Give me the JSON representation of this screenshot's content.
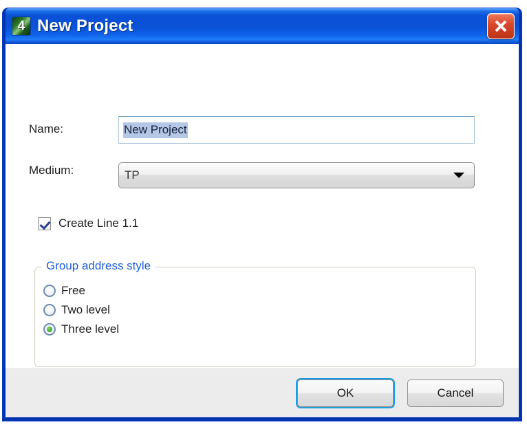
{
  "window": {
    "title": "New Project",
    "app_icon": "app-logo-icon",
    "app_icon_glyph": "4",
    "close_label": "close-icon",
    "accent_titlebar": "#0a51d8",
    "close_button_color": "#d9472a"
  },
  "form": {
    "name": {
      "label": "Name:",
      "value": "New Project",
      "selected": true,
      "selection_color": "#b4c7e7"
    },
    "medium": {
      "label": "Medium:",
      "value": "TP"
    },
    "create_line": {
      "label": "Create Line 1.1",
      "checked": true
    }
  },
  "group_address_style": {
    "legend": "Group address style",
    "legend_color": "#1f5fd8",
    "selected": "Three level",
    "options": [
      {
        "label": "Free",
        "selected": false
      },
      {
        "label": "Two level",
        "selected": false
      },
      {
        "label": "Three level",
        "selected": true
      }
    ]
  },
  "footer": {
    "ok_label": "OK",
    "cancel_label": "Cancel",
    "default_button": "OK",
    "focus_ring_color": "#1d9bdd"
  }
}
